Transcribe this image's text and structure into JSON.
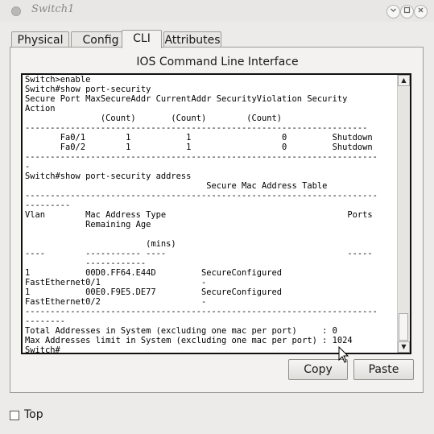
{
  "window": {
    "title": "Switch1",
    "minimize_glyph": "⌃",
    "maximize_glyph": "⌃",
    "close_glyph": "✕"
  },
  "tabs": [
    {
      "label": "Physical",
      "active": false
    },
    {
      "label": "Config",
      "active": false
    },
    {
      "label": "CLI",
      "active": true
    },
    {
      "label": "Attributes",
      "active": false
    }
  ],
  "panel": {
    "title": "IOS Command Line Interface"
  },
  "terminal": {
    "lines": [
      "Switch>enable",
      "Switch#show port-security",
      "Secure Port MaxSecureAddr CurrentAddr SecurityViolation Security",
      "Action",
      "               (Count)       (Count)        (Count)",
      "--------------------------------------------------------------------",
      "       Fa0/1        1           1                  0         Shutdown",
      "       Fa0/2        1           1                  0         Shutdown",
      "----------------------------------------------------------------------",
      "-",
      "Switch#show port-security address",
      "                                    Secure Mac Address Table",
      "----------------------------------------------------------------------",
      "---------",
      "Vlan        Mac Address Type                                    Ports",
      "            Remaining Age",
      "",
      "                        (mins)",
      "----        ----------- ----                                    -----",
      "            ------------",
      "1           00D0.FF64.E44D         SecureConfigured",
      "FastEthernet0/1                    -",
      "1           00E0.F9E5.DE77         SecureConfigured",
      "FastEthernet0/2                    -",
      "----------------------------------------------------------------------",
      "--------",
      "Total Addresses in System (excluding one mac per port)     : 0",
      "Max Addresses limit in System (excluding one mac per port) : 1024",
      "Switch#"
    ]
  },
  "buttons": {
    "copy_label": "Copy",
    "paste_label": "Paste"
  },
  "footer": {
    "top_label": "Top",
    "top_checked": false
  },
  "colors": {
    "window_bg": "#ecebe9",
    "terminal_bg": "#ffffff",
    "terminal_border": "#111111"
  },
  "icons": {
    "window_menu": "window-menu-icon",
    "scroll_up": "arrow-up-icon",
    "scroll_down": "arrow-down-icon",
    "cursor": "mouse-pointer-icon"
  }
}
